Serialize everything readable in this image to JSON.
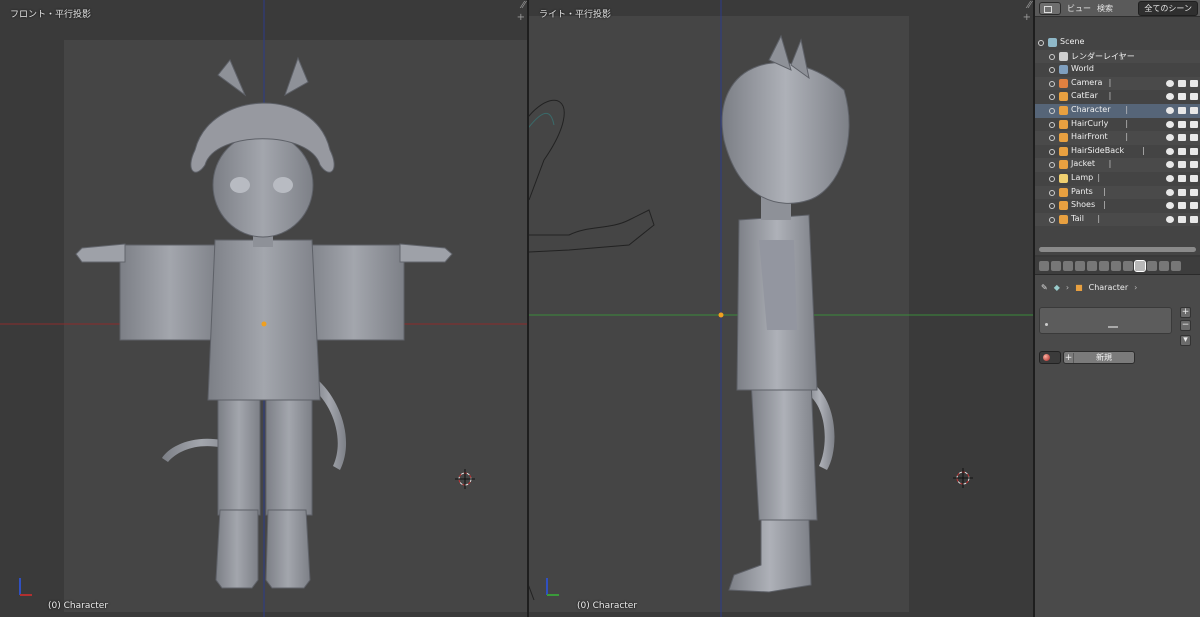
{
  "viewport_front": {
    "title": "フロント・平行投影",
    "footer": "(0) Character"
  },
  "viewport_right": {
    "title": "ライト・平行投影",
    "footer": "(0) Character"
  },
  "outliner": {
    "menu_view": "ビュー",
    "menu_search": "検索",
    "filter_select": "全てのシーン",
    "items": [
      {
        "label": "Scene",
        "icon": "scene-icon",
        "depth": 0,
        "extra": ""
      },
      {
        "label": "レンダーレイヤー",
        "icon": "render-layer-icon",
        "depth": 1,
        "extra": "|"
      },
      {
        "label": "World",
        "icon": "world-icon",
        "depth": 1,
        "extra": ""
      },
      {
        "label": "Camera",
        "icon": "camera-icon",
        "depth": 1,
        "extra": "|"
      },
      {
        "label": "CatEar",
        "icon": "mesh-icon",
        "depth": 1,
        "extra": "|"
      },
      {
        "label": "Character",
        "icon": "mesh-icon",
        "depth": 1,
        "extra": "|"
      },
      {
        "label": "HairCurly",
        "icon": "mesh-icon",
        "depth": 1,
        "extra": "|"
      },
      {
        "label": "HairFront",
        "icon": "mesh-icon",
        "depth": 1,
        "extra": "|"
      },
      {
        "label": "HairSideBack",
        "icon": "mesh-icon",
        "depth": 1,
        "extra": "|"
      },
      {
        "label": "Jacket",
        "icon": "mesh-icon",
        "depth": 1,
        "extra": "|"
      },
      {
        "label": "Lamp",
        "icon": "lamp-icon",
        "depth": 1,
        "extra": "|"
      },
      {
        "label": "Pants",
        "icon": "mesh-icon",
        "depth": 1,
        "extra": "|"
      },
      {
        "label": "Shoes",
        "icon": "mesh-icon",
        "depth": 1,
        "extra": "|"
      },
      {
        "label": "Tail",
        "icon": "mesh-icon",
        "depth": 1,
        "extra": "|"
      }
    ]
  },
  "properties": {
    "breadcrumb_object": "Character",
    "new_button": "新規"
  },
  "colors": {
    "x_axis": "#b03030",
    "y_axis": "#3a9a3a",
    "z_axis": "#3050c0",
    "selection": "#566578",
    "object_origin": "#f0a020"
  }
}
